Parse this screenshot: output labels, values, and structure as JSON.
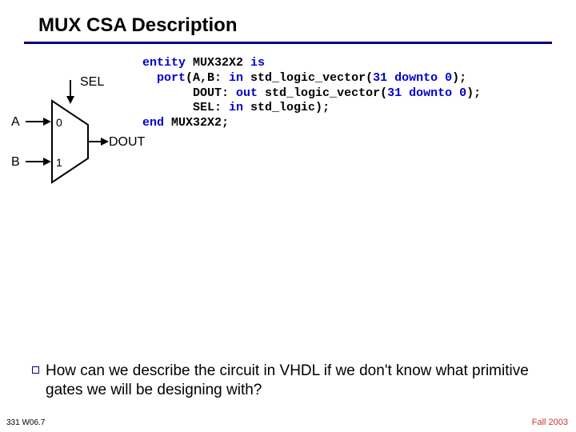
{
  "title": "MUX CSA Description",
  "diagram": {
    "sel": "SEL",
    "a": "A",
    "b": "B",
    "dout": "DOUT",
    "in0": "0",
    "in1": "1"
  },
  "code": {
    "l1a": "entity",
    "l1b": " MUX32X2 ",
    "l1c": "is",
    "l2a": "  port",
    "l2b": "(A,B: ",
    "l2c": "in",
    "l2d": " std_logic_vector(",
    "l2e": "31",
    "l2f": " ",
    "l2g": "downto",
    "l2h": " ",
    "l2i": "0",
    "l2j": ");",
    "l3a": "       DOUT: ",
    "l3b": "out",
    "l3c": " std_logic_vector(",
    "l3d": "31",
    "l3e": " ",
    "l3f": "downto",
    "l3g": " ",
    "l3h": "0",
    "l3i": ");",
    "l4a": "       SEL: ",
    "l4b": "in",
    "l4c": " std_logic);",
    "l5a": "end",
    "l5b": " MUX32X2;"
  },
  "question": "How can we describe the circuit in VHDL if we don't know what primitive gates we will be designing with?",
  "footer_left": "331  W06.7",
  "footer_right": "Fall 2003"
}
